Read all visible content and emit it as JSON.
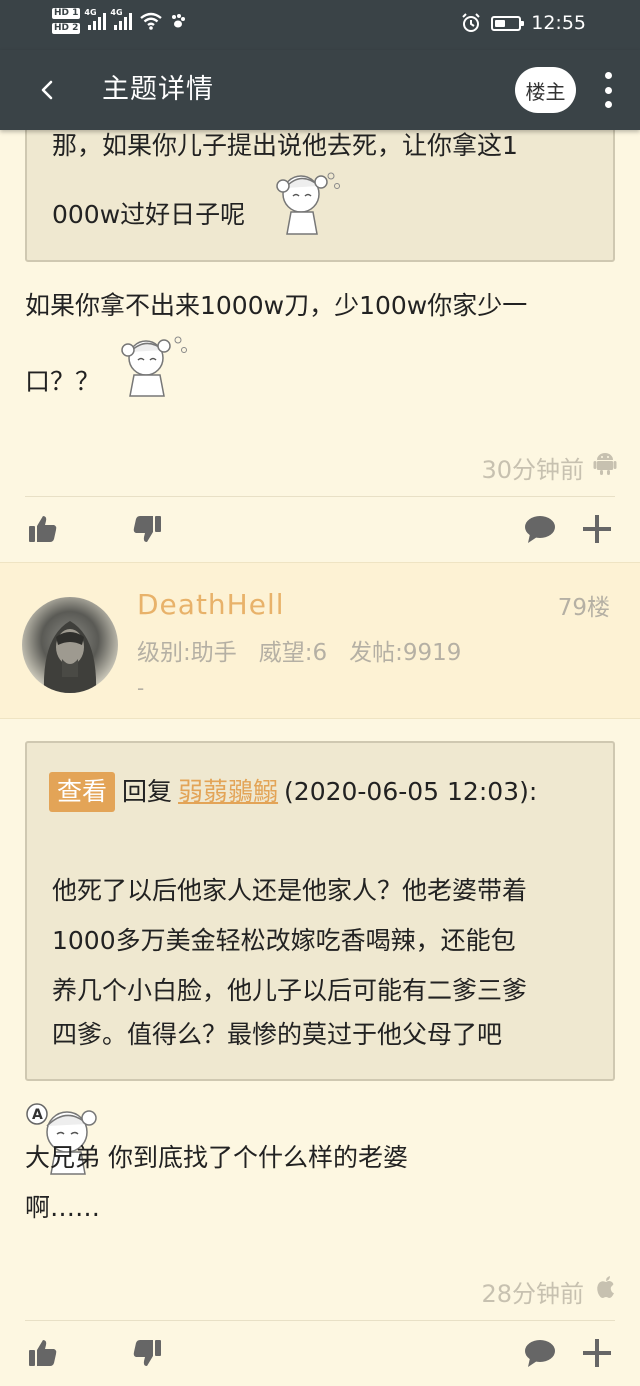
{
  "status_bar": {
    "sim1": "HD 1",
    "sim2": "HD 2",
    "network1": "4G",
    "network2": "4G",
    "time": "12:55",
    "battery_level": 0.45
  },
  "app_bar": {
    "title": "主题详情",
    "op_button": "楼主"
  },
  "post_78": {
    "quote_lines": [
      "那，如果你儿子提出说他去死，让你拿这1",
      "000w过好日子呢"
    ],
    "body_lines": [
      "如果你拿不出来1000w刀，少100w你家少一",
      "口？？"
    ],
    "time": "30分钟前",
    "client_icon": "android-icon"
  },
  "post_79": {
    "username": "DeathHell",
    "floor": "79楼",
    "level": "级别:助手",
    "prestige": "威望:6",
    "posts": "发帖:9919",
    "signature": "-",
    "quote": {
      "view_label": "查看",
      "reply_prefix": "回复",
      "reply_user": "弱蒻鶸鰯",
      "reply_time": "(2020-06-05 12:03):",
      "lines": [
        "他死了以后他家人还是他家人？他老婆带着",
        "1000多万美金轻松改嫁吃香喝辣，还能包",
        "养几个小白脸，他儿子以后可能有二爹三爹",
        "四爹。值得么？最惨的莫过于他父母了吧"
      ]
    },
    "body_lines": [
      "大兄弟 你到底找了个什么样的老婆",
      "啊……"
    ],
    "time": "28分钟前",
    "client_icon": "apple-icon"
  },
  "actions": {
    "like": "thumbs-up-icon",
    "dislike": "thumbs-down-icon",
    "comment": "comment-icon",
    "add": "plus-icon"
  },
  "colors": {
    "bar": "#3a4347",
    "page_bg": "#fdf7e1",
    "accent": "#e3a457",
    "quote_bg": "#efe8d0",
    "muted": "#b5b0a4"
  }
}
